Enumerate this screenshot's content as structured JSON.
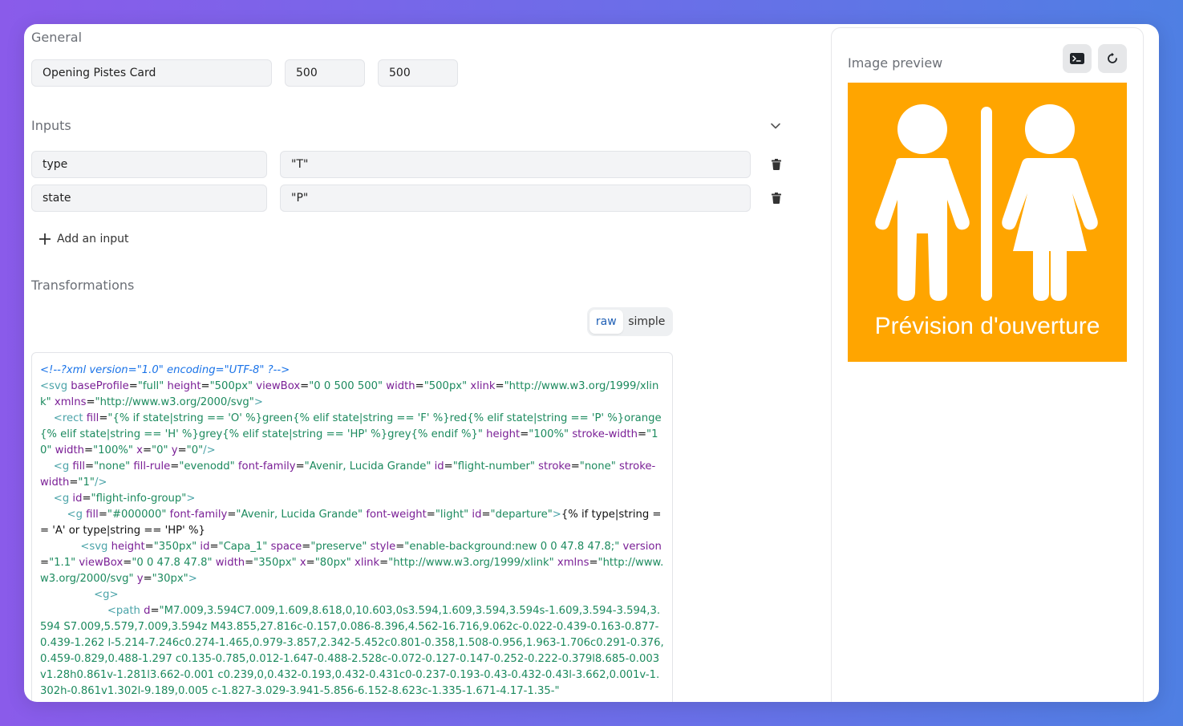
{
  "general": {
    "title": "General",
    "name_value": "Opening Pistes Card",
    "width_value": "500",
    "height_value": "500"
  },
  "inputs": {
    "title": "Inputs",
    "rows": [
      {
        "name": "type",
        "value": "\"T\""
      },
      {
        "name": "state",
        "value": "\"P\""
      }
    ],
    "add_label": "Add an input"
  },
  "transformations": {
    "title": "Transformations",
    "mode_raw": "raw",
    "mode_simple": "simple",
    "active_mode": "raw"
  },
  "preview": {
    "title": "Image preview",
    "caption": "Prévision d'ouverture",
    "background_color": "#FFA500"
  },
  "icons": {
    "collapse": "chevron-down-icon",
    "delete": "trash-icon",
    "add": "plus-icon",
    "terminal": "terminal-icon",
    "refresh": "refresh-icon"
  },
  "colors": {
    "accent": "#1f5fb5",
    "code_comment": "#1a73e8",
    "code_attribute": "#7a1f96",
    "code_string": "#1c8a5e"
  },
  "code": {
    "tokens": [
      {
        "t": "cm",
        "v": "<!--?xml version=\"1.0\" encoding=\"UTF-8\" ?-->"
      },
      {
        "t": "tx",
        "v": "\n"
      },
      {
        "t": "tag",
        "v": "<svg "
      },
      {
        "t": "at",
        "v": "baseProfile"
      },
      {
        "t": "tx",
        "v": "="
      },
      {
        "t": "st",
        "v": "\"full\""
      },
      {
        "t": "tx",
        "v": " "
      },
      {
        "t": "at",
        "v": "height"
      },
      {
        "t": "tx",
        "v": "="
      },
      {
        "t": "st",
        "v": "\"500px\""
      },
      {
        "t": "tx",
        "v": " "
      },
      {
        "t": "at",
        "v": "viewBox"
      },
      {
        "t": "tx",
        "v": "="
      },
      {
        "t": "st",
        "v": "\"0 0 500 500\""
      },
      {
        "t": "tx",
        "v": " "
      },
      {
        "t": "at",
        "v": "width"
      },
      {
        "t": "tx",
        "v": "="
      },
      {
        "t": "st",
        "v": "\"500px\""
      },
      {
        "t": "tx",
        "v": " "
      },
      {
        "t": "at",
        "v": "xlink"
      },
      {
        "t": "tx",
        "v": "="
      },
      {
        "t": "st",
        "v": "\"http://www.w3.org/1999/xlink\""
      },
      {
        "t": "tx",
        "v": " "
      },
      {
        "t": "at",
        "v": "xmlns"
      },
      {
        "t": "tx",
        "v": "="
      },
      {
        "t": "st",
        "v": "\"http://www.w3.org/2000/svg\""
      },
      {
        "t": "tag",
        "v": ">"
      },
      {
        "t": "tx",
        "v": "\n    "
      },
      {
        "t": "tag",
        "v": "<rect "
      },
      {
        "t": "at",
        "v": "fill"
      },
      {
        "t": "tx",
        "v": "="
      },
      {
        "t": "st",
        "v": "\"{% if state|string == 'O' %}green{% elif state|string == 'F' %}red{% elif state|string == 'P' %}orange{% elif state|string == 'H' %}grey{% elif state|string == 'HP' %}grey{% endif %}\""
      },
      {
        "t": "tx",
        "v": " "
      },
      {
        "t": "at",
        "v": "height"
      },
      {
        "t": "tx",
        "v": "="
      },
      {
        "t": "st",
        "v": "\"100%\""
      },
      {
        "t": "tx",
        "v": " "
      },
      {
        "t": "at",
        "v": "stroke-width"
      },
      {
        "t": "tx",
        "v": "="
      },
      {
        "t": "st",
        "v": "\"10\""
      },
      {
        "t": "tx",
        "v": " "
      },
      {
        "t": "at",
        "v": "width"
      },
      {
        "t": "tx",
        "v": "="
      },
      {
        "t": "st",
        "v": "\"100%\""
      },
      {
        "t": "tx",
        "v": " "
      },
      {
        "t": "at",
        "v": "x"
      },
      {
        "t": "tx",
        "v": "="
      },
      {
        "t": "st",
        "v": "\"0\""
      },
      {
        "t": "tx",
        "v": " "
      },
      {
        "t": "at",
        "v": "y"
      },
      {
        "t": "tx",
        "v": "="
      },
      {
        "t": "st",
        "v": "\"0\""
      },
      {
        "t": "tag",
        "v": "/>"
      },
      {
        "t": "tx",
        "v": "\n    "
      },
      {
        "t": "tag",
        "v": "<g "
      },
      {
        "t": "at",
        "v": "fill"
      },
      {
        "t": "tx",
        "v": "="
      },
      {
        "t": "st",
        "v": "\"none\""
      },
      {
        "t": "tx",
        "v": " "
      },
      {
        "t": "at",
        "v": "fill-rule"
      },
      {
        "t": "tx",
        "v": "="
      },
      {
        "t": "st",
        "v": "\"evenodd\""
      },
      {
        "t": "tx",
        "v": " "
      },
      {
        "t": "at",
        "v": "font-family"
      },
      {
        "t": "tx",
        "v": "="
      },
      {
        "t": "st",
        "v": "\"Avenir, Lucida Grande\""
      },
      {
        "t": "tx",
        "v": " "
      },
      {
        "t": "at",
        "v": "id"
      },
      {
        "t": "tx",
        "v": "="
      },
      {
        "t": "st",
        "v": "\"flight-number\""
      },
      {
        "t": "tx",
        "v": " "
      },
      {
        "t": "at",
        "v": "stroke"
      },
      {
        "t": "tx",
        "v": "="
      },
      {
        "t": "st",
        "v": "\"none\""
      },
      {
        "t": "tx",
        "v": " "
      },
      {
        "t": "at",
        "v": "stroke-width"
      },
      {
        "t": "tx",
        "v": "="
      },
      {
        "t": "st",
        "v": "\"1\""
      },
      {
        "t": "tag",
        "v": "/>"
      },
      {
        "t": "tx",
        "v": "\n    "
      },
      {
        "t": "tag",
        "v": "<g "
      },
      {
        "t": "at",
        "v": "id"
      },
      {
        "t": "tx",
        "v": "="
      },
      {
        "t": "st",
        "v": "\"flight-info-group\""
      },
      {
        "t": "tag",
        "v": ">"
      },
      {
        "t": "tx",
        "v": "\n        "
      },
      {
        "t": "tag",
        "v": "<g "
      },
      {
        "t": "at",
        "v": "fill"
      },
      {
        "t": "tx",
        "v": "="
      },
      {
        "t": "st",
        "v": "\"#000000\""
      },
      {
        "t": "tx",
        "v": " "
      },
      {
        "t": "at",
        "v": "font-family"
      },
      {
        "t": "tx",
        "v": "="
      },
      {
        "t": "st",
        "v": "\"Avenir, Lucida Grande\""
      },
      {
        "t": "tx",
        "v": " "
      },
      {
        "t": "at",
        "v": "font-weight"
      },
      {
        "t": "tx",
        "v": "="
      },
      {
        "t": "st",
        "v": "\"light\""
      },
      {
        "t": "tx",
        "v": " "
      },
      {
        "t": "at",
        "v": "id"
      },
      {
        "t": "tx",
        "v": "="
      },
      {
        "t": "st",
        "v": "\"departure\""
      },
      {
        "t": "tag",
        "v": ">"
      },
      {
        "t": "tx",
        "v": "{% if type|string == 'A' or type|string == 'HP' %}"
      },
      {
        "t": "tx",
        "v": "\n            "
      },
      {
        "t": "tag",
        "v": "<svg "
      },
      {
        "t": "at",
        "v": "height"
      },
      {
        "t": "tx",
        "v": "="
      },
      {
        "t": "st",
        "v": "\"350px\""
      },
      {
        "t": "tx",
        "v": " "
      },
      {
        "t": "at",
        "v": "id"
      },
      {
        "t": "tx",
        "v": "="
      },
      {
        "t": "st",
        "v": "\"Capa_1\""
      },
      {
        "t": "tx",
        "v": " "
      },
      {
        "t": "at",
        "v": "space"
      },
      {
        "t": "tx",
        "v": "="
      },
      {
        "t": "st",
        "v": "\"preserve\""
      },
      {
        "t": "tx",
        "v": " "
      },
      {
        "t": "at",
        "v": "style"
      },
      {
        "t": "tx",
        "v": "="
      },
      {
        "t": "st",
        "v": "\"enable-background:new 0 0 47.8 47.8;\""
      },
      {
        "t": "tx",
        "v": " "
      },
      {
        "t": "at",
        "v": "version"
      },
      {
        "t": "tx",
        "v": "="
      },
      {
        "t": "st",
        "v": "\"1.1\""
      },
      {
        "t": "tx",
        "v": " "
      },
      {
        "t": "at",
        "v": "viewBox"
      },
      {
        "t": "tx",
        "v": "="
      },
      {
        "t": "st",
        "v": "\"0 0 47.8 47.8\""
      },
      {
        "t": "tx",
        "v": " "
      },
      {
        "t": "at",
        "v": "width"
      },
      {
        "t": "tx",
        "v": "="
      },
      {
        "t": "st",
        "v": "\"350px\""
      },
      {
        "t": "tx",
        "v": " "
      },
      {
        "t": "at",
        "v": "x"
      },
      {
        "t": "tx",
        "v": "="
      },
      {
        "t": "st",
        "v": "\"80px\""
      },
      {
        "t": "tx",
        "v": " "
      },
      {
        "t": "at",
        "v": "xlink"
      },
      {
        "t": "tx",
        "v": "="
      },
      {
        "t": "st",
        "v": "\"http://www.w3.org/1999/xlink\""
      },
      {
        "t": "tx",
        "v": " "
      },
      {
        "t": "at",
        "v": "xmlns"
      },
      {
        "t": "tx",
        "v": "="
      },
      {
        "t": "st",
        "v": "\"http://www.w3.org/2000/svg\""
      },
      {
        "t": "tx",
        "v": " "
      },
      {
        "t": "at",
        "v": "y"
      },
      {
        "t": "tx",
        "v": "="
      },
      {
        "t": "st",
        "v": "\"30px\""
      },
      {
        "t": "tag",
        "v": ">"
      },
      {
        "t": "tx",
        "v": "\n                "
      },
      {
        "t": "tag",
        "v": "<g>"
      },
      {
        "t": "tx",
        "v": "\n                    "
      },
      {
        "t": "tag",
        "v": "<path "
      },
      {
        "t": "at",
        "v": "d"
      },
      {
        "t": "tx",
        "v": "="
      },
      {
        "t": "st",
        "v": "\"M7.009,3.594C7.009,1.609,8.618,0,10.603,0s3.594,1.609,3.594,3.594s-1.609,3.594-3.594,3.594 S7.009,5.579,7.009,3.594z M43.855,27.816c-0.157,0.086-8.396,4.562-16.716,9.062c-0.022-0.439-0.163-0.877-0.439-1.262 l-5.214-7.246c0.274-1.465,0.979-3.857,2.342-5.452c0.801-0.358,1.508-0.956,1.963-1.706c0.291-0.376,0.459-0.829,0.488-1.297 c0.135-0.785,0.012-1.647-0.488-2.528c-0.072-0.127-0.147-0.252-0.222-0.379l8.685-0.003v1.28h0.861v-1.281l3.662-0.001 c0.239,0,0.432-0.193,0.432-0.431c0-0.237-0.193-0.43-0.432-0.43l-3.662,0.001v-1.302h-0.861v1.302l-9.189,0.005 c-1.827-3.029-3.941-5.856-6.152-8.623c-1.335-1.671-4.17-1.35-\""
      }
    ]
  }
}
